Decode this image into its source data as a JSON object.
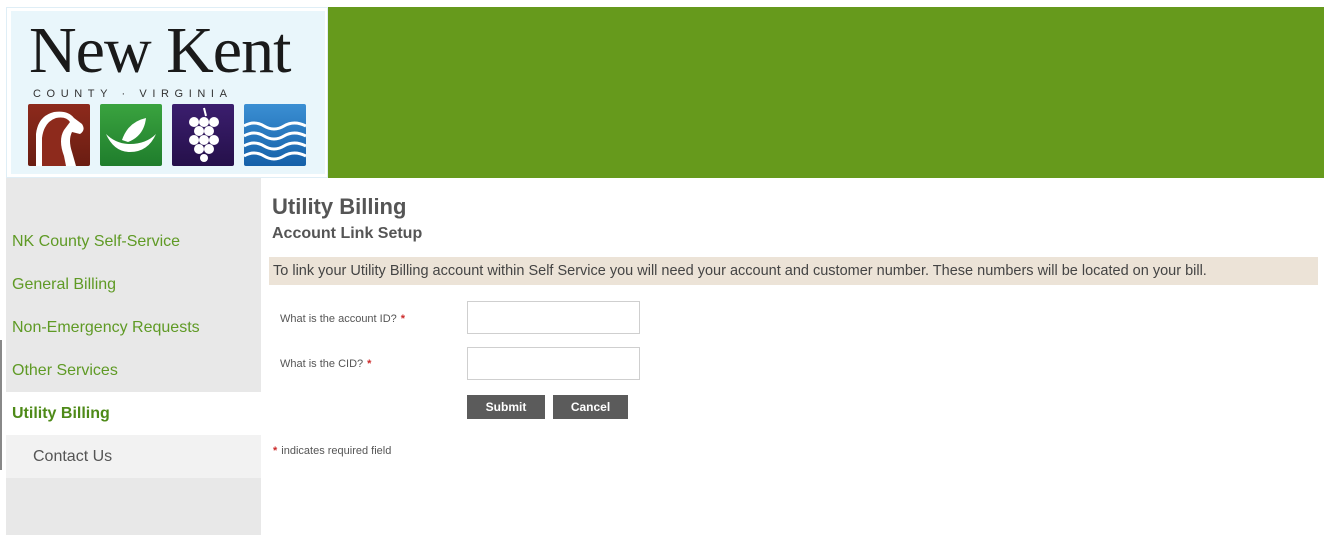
{
  "header": {
    "logo_title": "New Kent",
    "logo_subtitle": "COUNTY · VIRGINIA",
    "accent_color": "#669a1c",
    "logo_icons": [
      "horse-icon",
      "leaf-hands-icon",
      "grapes-icon",
      "water-waves-icon"
    ]
  },
  "sidebar": {
    "items": [
      {
        "label": "NK County Self-Service"
      },
      {
        "label": "General Billing"
      },
      {
        "label": "Non-Emergency Requests"
      },
      {
        "label": "Other Services"
      },
      {
        "label": "Utility Billing",
        "active": true
      },
      {
        "label": "Contact Us",
        "sub": true
      }
    ]
  },
  "main": {
    "title": "Utility Billing",
    "subtitle": "Account Link Setup",
    "info_text": "To link your Utility Billing account within Self Service you will need your account and customer number. These numbers will be located on your bill.",
    "fields": [
      {
        "label": "What is the account ID?",
        "required_mark": "*",
        "value": ""
      },
      {
        "label": "What is the CID?",
        "required_mark": "*",
        "value": ""
      }
    ],
    "submit_label": "Submit",
    "cancel_label": "Cancel",
    "required_note_mark": "*",
    "required_note": "indicates required field"
  }
}
